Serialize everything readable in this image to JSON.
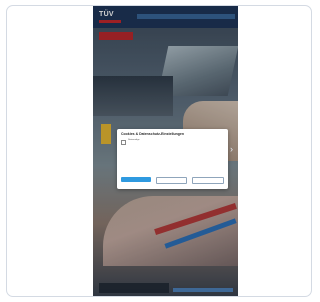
{
  "header": {
    "logo_text": "TÜV"
  },
  "cookie_modal": {
    "title": "Cookies & Datenschutz-Einstellungen",
    "body": "",
    "options": [
      {
        "label": "Notwendige",
        "checked": false
      }
    ],
    "accept_all_label": "",
    "reject_label": "",
    "settings_label": ""
  },
  "colors": {
    "header_bg": "#1e3558",
    "brand_red": "#c0282d",
    "accent_blue": "#2f9ae0"
  }
}
